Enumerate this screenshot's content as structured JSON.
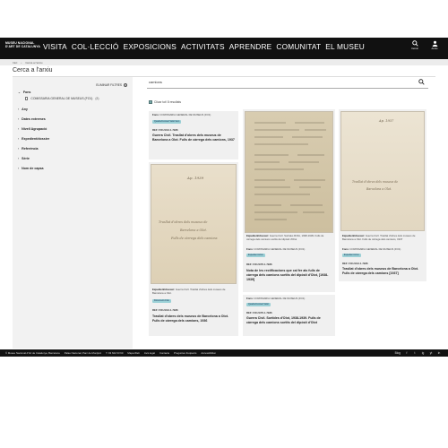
{
  "header": {
    "logo_line1": "MUSEU NACIONAL",
    "logo_line2": "D'ART DE CATALUNYA",
    "nav": [
      "VISITA",
      "COL·LECCIÓ",
      "EXPOSICIONS",
      "ACTIVITATS",
      "APRENDRE",
      "COMUNITAT",
      "EL MUSEU"
    ],
    "search_label": "Cercar",
    "user_label": "Accés"
  },
  "breadcrumb": [
    "Inici",
    "Cerca a l'arxiu"
  ],
  "page": {
    "title": "Cerca a l'arxiu"
  },
  "sidebar": {
    "clear_filters": "ELIMINAR FILTRES",
    "fons_label": "Fons",
    "fons_value": "COMISSARIA GENERAL DE MUSEUS (FO1)",
    "fons_count": "(8)",
    "filters": [
      "Any",
      "Dates extremes",
      "Nivell Agrupació",
      "Expedient/dossier",
      "Referència",
      "Sèrie",
      "Nom de capsa"
    ]
  },
  "search": {
    "value": "camions"
  },
  "results": {
    "select_all": "Clicar tot/ 8 resultats"
  },
  "cards": [
    {
      "fons_label": "Fons:",
      "fons": "COMISSARIA GENERAL DE MUSEUS (FO1)",
      "tag": "Quadre/Context Valor Item",
      "ref": "REF: FO1/1/13-1-7936",
      "title": "Guerra Civil. Trasllat d'obres dels museus de Barcelona a Olot. Fulls de càrrega dels camions, 1937"
    },
    {
      "doc_text": [
        "Ap. 1939",
        "Trasllat d'obres dels museus de",
        "Barcelona a Olot.",
        "Fulls de càrrega dels camions"
      ],
      "exp_label": "Expedient/dossier:",
      "exp": "Guerra Civil. Trasllat d'obres dels museus de Barcelona a Olot.",
      "tag": "Document Arxiu",
      "ref": "REF: FO1/1/13-1-7936",
      "title": "Trasllat d'obres dels museus de Barcelona a Olot. Fulls de càrrega dels camions, 1936"
    },
    {
      "exp_label": "Expedient/dossier:",
      "exp": "Guerra Civil. Sortides ROIA, 1938-1939. Fulls de càrrega dels camions sortits del dipòsit d'Olot",
      "fons_label": "Fons:",
      "fons": "COMISSARIA GENERAL DE MUSEUS (FO1)",
      "tag": "Expedient Arxiu",
      "ref": "REF: FO1/1/76-1-7936",
      "title": "Nota de les rectificacions que cal fer als fulls de càrrega dels camions sortits del dipòsit d'Olot, [1938-1939]"
    },
    {
      "fons_label": "Fons:",
      "fons": "COMISSARIA GENERAL DE MUSEUS (FO1)",
      "tag": "Quadre/Context Valor",
      "ref": "REF: FO1/1/76-1-7936",
      "title": "Guerra Civil. Sortides d'Olot, 1938-1939. Fulls de càrrega dels camions sortits del dipòsit d'Olot"
    },
    {
      "doc_text": [
        "Ap. 1937",
        "Trasllat d'obres dels museus de",
        "Barcelona a Olot."
      ],
      "exp_label": "Expedient/dossier:",
      "exp": "Guerra Civil. Trasllat d'obres dels museus de Barcelona a Olot. Fulls de càrrega dels camions, 1937",
      "fons_label": "Fons:",
      "fons": "COMISSARIA GENERAL DE MUSEUS (FO1)",
      "tag": "Expedient Arxiu",
      "ref": "REF: FO1/1/13-1-7936",
      "title": "Trasllat d'obres dels museus de Barcelona a Olot. Fulls de càrrega dels camions [1937]"
    }
  ],
  "footer": {
    "links": [
      "© Museu Nacional d'Art de Catalunya, Barcelona",
      "Palau Nacional, Parc de Montjuïc",
      "T. 93 622 03 60",
      "Mapa Web",
      "Avís legal",
      "Contacte",
      "Preguntes freqüents",
      "Accessibilitat"
    ],
    "social": [
      "Blog",
      "f",
      "t",
      "ig",
      "yt",
      "in"
    ]
  }
}
